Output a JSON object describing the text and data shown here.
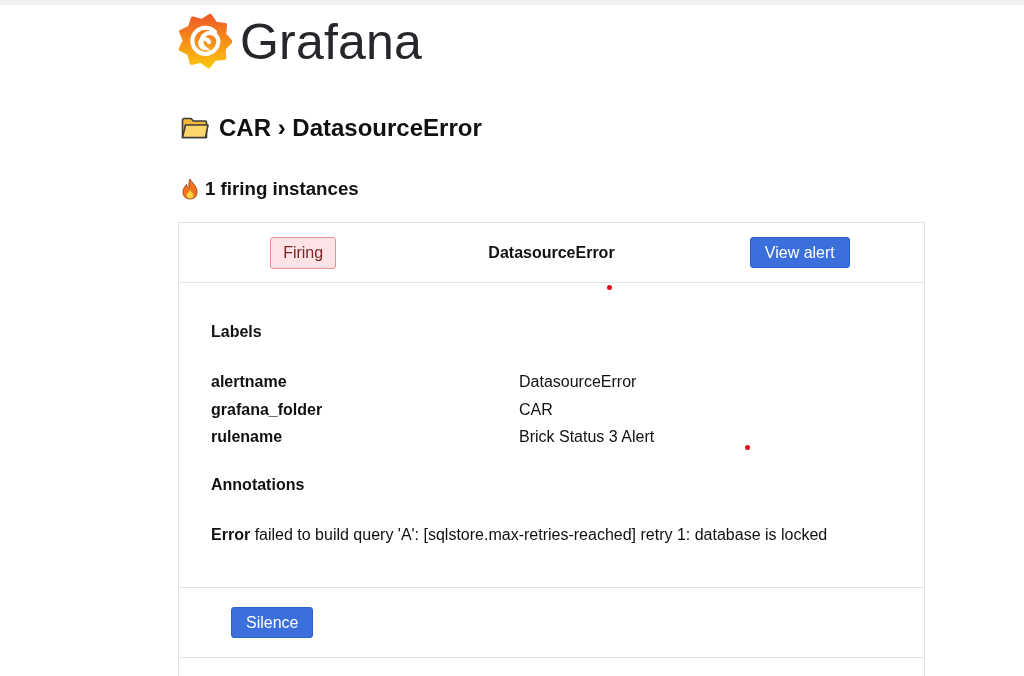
{
  "logo": {
    "wordmark": "Grafana"
  },
  "title": "CAR › DatasourceError",
  "firing_summary": "1 firing instances",
  "alert_card": {
    "header": {
      "state_badge": {
        "label": "Firing",
        "kind": "firing"
      },
      "alert_name": "DatasourceError",
      "view_button": "View alert"
    },
    "labels_heading": "Labels",
    "labels": [
      {
        "name": "alertname",
        "value": "DatasourceError"
      },
      {
        "name": "grafana_folder",
        "value": "CAR"
      },
      {
        "name": "rulename",
        "value": "Brick Status 3 Alert"
      }
    ],
    "annotations_heading": "Annotations",
    "annotations": [
      {
        "name": "Error",
        "value": "failed to build query 'A': [sqlstore.max-retries-reached] retry 1: database is locked"
      }
    ],
    "actions": [
      "Silence"
    ]
  }
}
